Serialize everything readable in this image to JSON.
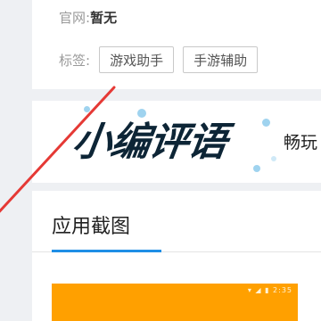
{
  "info": {
    "website_label": "官网:",
    "website_value": "暂无",
    "tags_label": "标签:",
    "tags": [
      "游戏助手",
      "手游辅助"
    ],
    "right_edge_text": "|"
  },
  "review_banner": {
    "title": "小编评语",
    "subtitle": "畅玩"
  },
  "screenshots": {
    "title": "应用截图",
    "status_bar_text": "▾ ◢ ▮ 2:35"
  },
  "colors": {
    "accent_underline": "#1f8ee6",
    "screenshot_bg": "#ffa000",
    "annotation_arrow": "#e53935"
  }
}
